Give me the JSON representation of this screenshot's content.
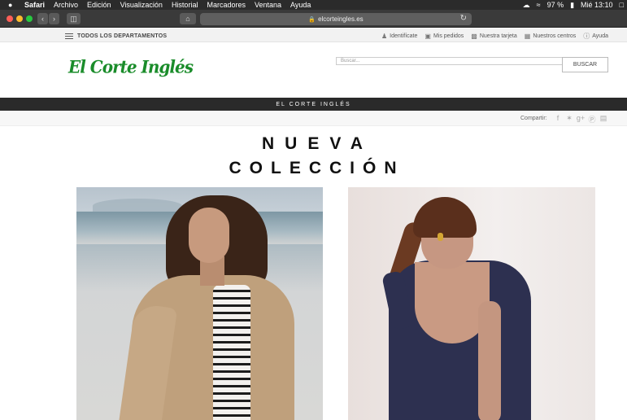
{
  "menubar": {
    "apple": "",
    "items": [
      "Safari",
      "Archivo",
      "Edición",
      "Visualización",
      "Historial",
      "Marcadores",
      "Ventana",
      "Ayuda"
    ],
    "battery": "97 %",
    "clock": "Mié 13:10"
  },
  "browser": {
    "url": "elcorteingles.es"
  },
  "site": {
    "departments": "TODOS LOS DEPARTAMENTOS",
    "links": [
      "Identifícate",
      "Mis pedidos",
      "Nuestra tarjeta",
      "Nuestros centros",
      "Ayuda"
    ],
    "logo": "El Corte Inglés",
    "search_placeholder": "Buscar...",
    "search_button": "BUSCAR",
    "band_title": "EL CORTE INGLÉS",
    "share_label": "Compartir:",
    "headline_line1": "NUEVA",
    "headline_line2": "COLECCIÓN"
  },
  "colors": {
    "brand_green": "#1a8c2a",
    "band": "#2a2a2a"
  }
}
